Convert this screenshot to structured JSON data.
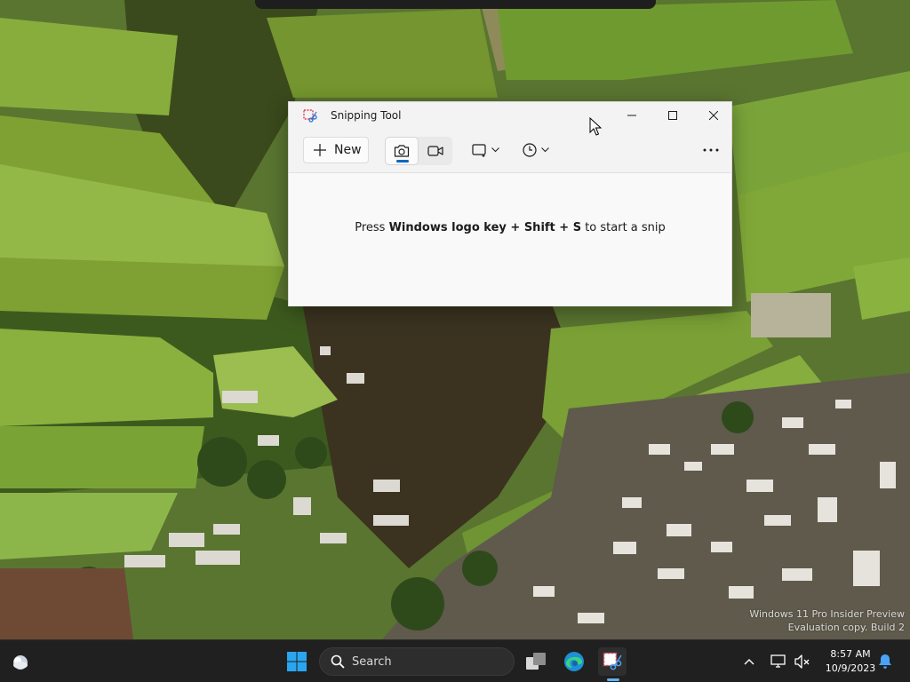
{
  "window": {
    "title": "Snipping Tool",
    "new_label": "New",
    "hint_prefix": "Press ",
    "hint_bold": "Windows logo key + Shift + S",
    "hint_suffix": " to start a snip"
  },
  "taskbar": {
    "search_placeholder": "Search",
    "time": "8:57 AM",
    "date": "10/9/2023"
  },
  "watermark": {
    "line1": "Windows 11 Pro Insider Preview",
    "line2": "Evaluation copy. Build 2"
  },
  "colors": {
    "accent": "#0067c0",
    "taskbar": "#202020",
    "window_bg": "#f3f3f3"
  }
}
